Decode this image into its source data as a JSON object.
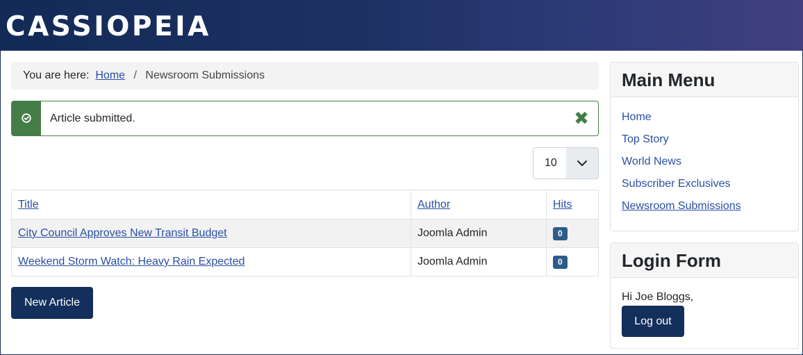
{
  "site": {
    "brand": "CASSIOPEIA"
  },
  "breadcrumb": {
    "prefix": "You are here:",
    "home": "Home",
    "separator": "/",
    "current": "Newsroom Submissions"
  },
  "alert": {
    "message": "Article submitted.",
    "icon": "check-circle-icon",
    "close_icon": "close-icon",
    "close_glyph": "✖",
    "color": "#457d46"
  },
  "list_limit": {
    "value": "10"
  },
  "table": {
    "headers": {
      "title": "Title",
      "author": "Author",
      "hits": "Hits"
    },
    "rows": [
      {
        "title": "City Council Approves New Transit Budget",
        "author": "Joomla Admin",
        "hits": "0"
      },
      {
        "title": "Weekend Storm Watch: Heavy Rain Expected",
        "author": "Joomla Admin",
        "hits": "0"
      }
    ]
  },
  "actions": {
    "new_article": "New Article"
  },
  "main_menu": {
    "title": "Main Menu",
    "items": [
      {
        "label": "Home"
      },
      {
        "label": "Top Story"
      },
      {
        "label": "World News"
      },
      {
        "label": "Subscriber Exclusives"
      },
      {
        "label": "Newsroom Submissions",
        "current": true
      }
    ]
  },
  "login_form": {
    "title": "Login Form",
    "greeting": "Hi Joe Bloggs,",
    "logout_label": "Log out"
  },
  "colors": {
    "header_start": "#132a57",
    "header_end": "#413f7f",
    "primary_button": "#132f5b",
    "link": "#2a4fa3",
    "badge": "#2d5c88",
    "success": "#457d46"
  }
}
